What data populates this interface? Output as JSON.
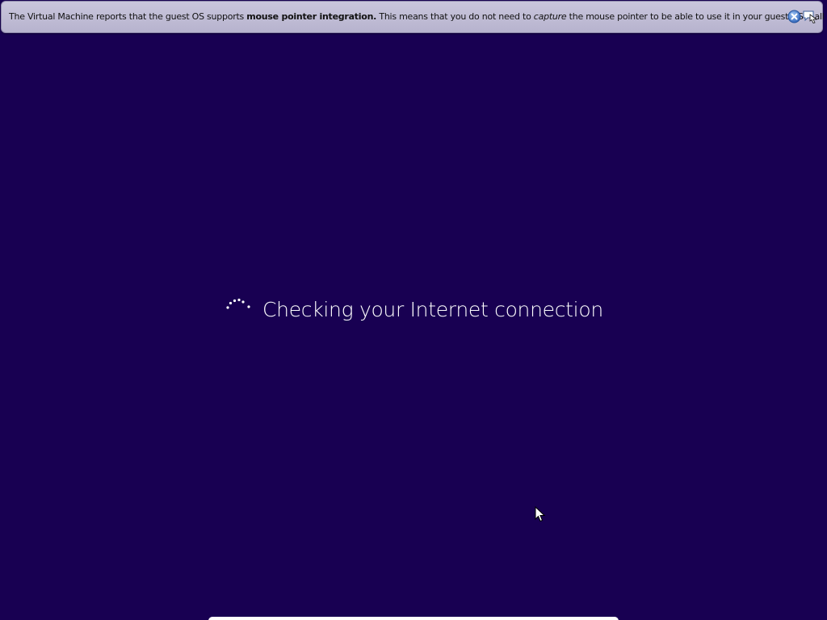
{
  "vm_banner": {
    "text_prefix": "The Virtual Machine reports that the guest OS supports ",
    "text_bold": "mouse pointer integration.",
    "text_middle": " This means that you do not need to ",
    "text_italic": "capture",
    "text_suffix": " the mouse pointer to be able to use it in your guest OS -- all mouse",
    "close_icon": "close-icon",
    "notify_icon": "notification-icon"
  },
  "setup": {
    "status_text": "Checking your Internet connection",
    "spinner_icon": "loading-spinner-icon"
  },
  "colors": {
    "background": "#180052",
    "text": "#ffffff",
    "banner": "#c9c6dc"
  }
}
